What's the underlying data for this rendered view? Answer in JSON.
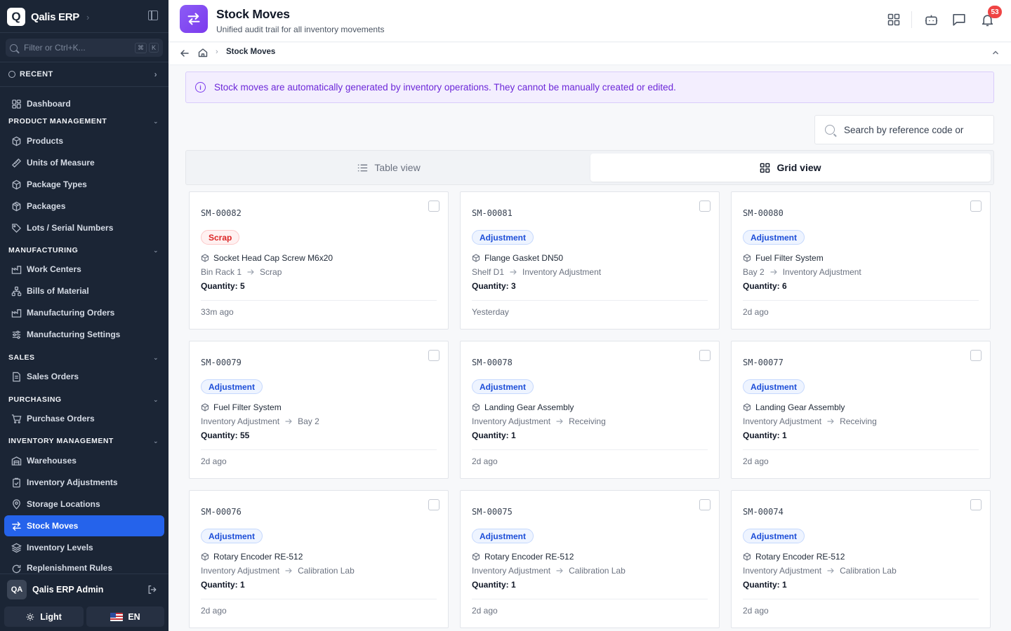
{
  "app": {
    "logo_letter": "Q",
    "name": "Qalis ERP"
  },
  "sidebar": {
    "filter_placeholder": "Filter or Ctrl+K...",
    "filter_keys": [
      "⌘",
      "K"
    ],
    "recent_label": "RECENT",
    "dashboard_label": "Dashboard",
    "sections": {
      "product": "PRODUCT MANAGEMENT",
      "manufacturing": "MANUFACTURING",
      "sales": "SALES",
      "purchasing": "PURCHASING",
      "inventory": "INVENTORY MANAGEMENT"
    },
    "items": {
      "products": "Products",
      "uom": "Units of Measure",
      "package_types": "Package Types",
      "packages": "Packages",
      "lots": "Lots / Serial Numbers",
      "work_centers": "Work Centers",
      "boms": "Bills of Material",
      "mos": "Manufacturing Orders",
      "mfg_settings": "Manufacturing Settings",
      "sales_orders": "Sales Orders",
      "purchase_orders": "Purchase Orders",
      "warehouses": "Warehouses",
      "inv_adjustments": "Inventory Adjustments",
      "storage_locations": "Storage Locations",
      "stock_moves": "Stock Moves",
      "inventory_levels": "Inventory Levels",
      "replenishment": "Replenishment Rules"
    },
    "user": {
      "initials": "QA",
      "name": "Qalis ERP Admin"
    },
    "theme_label": "Light",
    "language_label": "EN",
    "active_color": "#2563eb"
  },
  "header": {
    "title": "Stock Moves",
    "subtitle": "Unified audit trail for all inventory movements",
    "notification_count": "53"
  },
  "breadcrumb": {
    "current": "Stock Moves"
  },
  "info_banner": "Stock moves are automatically generated by inventory operations. They cannot be manually created or edited.",
  "search": {
    "placeholder": "Search by reference code or"
  },
  "view_tabs": {
    "table": "Table view",
    "grid": "Grid view",
    "selected": "Grid view"
  },
  "moves": [
    {
      "code": "SM-00082",
      "type": "Scrap",
      "product": "Socket Head Cap Screw M6x20",
      "from": "Bin Rack 1",
      "to": "Scrap",
      "quantity": "Quantity: 5",
      "time": "33m ago"
    },
    {
      "code": "SM-00081",
      "type": "Adjustment",
      "product": "Flange Gasket DN50",
      "from": "Shelf D1",
      "to": "Inventory Adjustment",
      "quantity": "Quantity: 3",
      "time": "Yesterday"
    },
    {
      "code": "SM-00080",
      "type": "Adjustment",
      "product": "Fuel Filter System",
      "from": "Bay 2",
      "to": "Inventory Adjustment",
      "quantity": "Quantity: 6",
      "time": "2d ago"
    },
    {
      "code": "SM-00079",
      "type": "Adjustment",
      "product": "Fuel Filter System",
      "from": "Inventory Adjustment",
      "to": "Bay 2",
      "quantity": "Quantity: 55",
      "time": "2d ago"
    },
    {
      "code": "SM-00078",
      "type": "Adjustment",
      "product": "Landing Gear Assembly",
      "from": "Inventory Adjustment",
      "to": "Receiving",
      "quantity": "Quantity: 1",
      "time": "2d ago"
    },
    {
      "code": "SM-00077",
      "type": "Adjustment",
      "product": "Landing Gear Assembly",
      "from": "Inventory Adjustment",
      "to": "Receiving",
      "quantity": "Quantity: 1",
      "time": "2d ago"
    },
    {
      "code": "SM-00076",
      "type": "Adjustment",
      "product": "Rotary Encoder RE-512",
      "from": "Inventory Adjustment",
      "to": "Calibration Lab",
      "quantity": "Quantity: 1",
      "time": "2d ago"
    },
    {
      "code": "SM-00075",
      "type": "Adjustment",
      "product": "Rotary Encoder RE-512",
      "from": "Inventory Adjustment",
      "to": "Calibration Lab",
      "quantity": "Quantity: 1",
      "time": "2d ago"
    },
    {
      "code": "SM-00074",
      "type": "Adjustment",
      "product": "Rotary Encoder RE-512",
      "from": "Inventory Adjustment",
      "to": "Calibration Lab",
      "quantity": "Quantity: 1",
      "time": "2d ago"
    }
  ]
}
